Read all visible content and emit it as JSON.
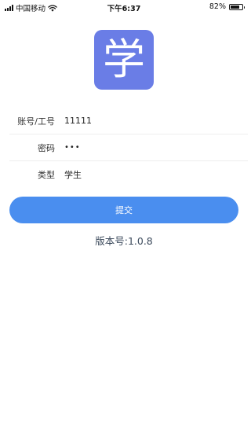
{
  "status_bar": {
    "carrier": "中国移动",
    "time": "下午6:37",
    "battery_percent": "82%",
    "battery_level": 0.82
  },
  "logo": {
    "glyph": "学",
    "color": "#6a7de6"
  },
  "form": {
    "account": {
      "label": "账号/工号",
      "value": "11111"
    },
    "password": {
      "label": "密码",
      "value": "•••"
    },
    "type": {
      "label": "类型",
      "value": "学生"
    }
  },
  "submit": {
    "label": "提交",
    "color": "#4a8eef"
  },
  "version": {
    "text": "版本号:1.0.8"
  }
}
